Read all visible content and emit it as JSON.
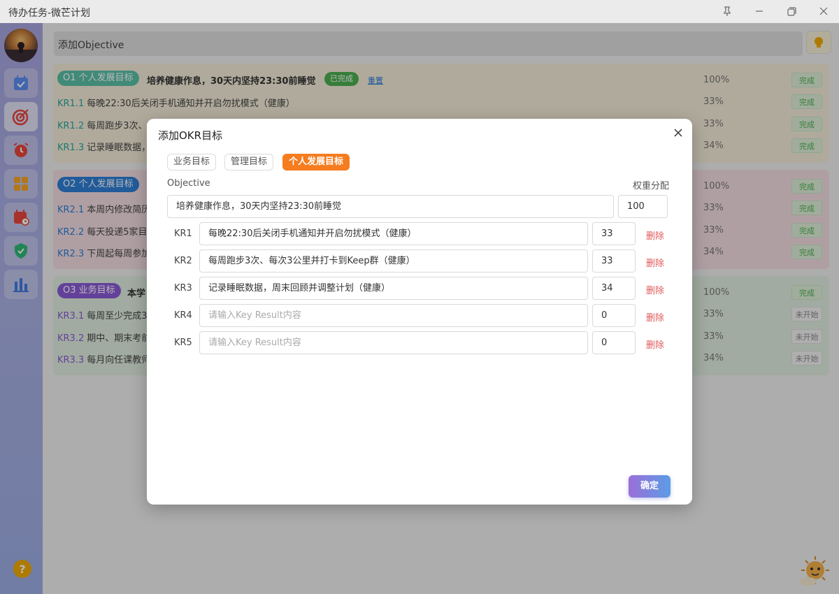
{
  "window": {
    "title": "待办任务-微芒计划",
    "buttons": [
      "pin",
      "minimize",
      "maximize",
      "close"
    ]
  },
  "main": {
    "add_objective_placeholder": "添加Objective",
    "groups": [
      {
        "tag": "O1 个人发展目标",
        "tag_color": "#5bbfa7",
        "title": "培养健康作息，30天内坚持23:30前睡觉",
        "done_badge": "已完成",
        "reset_label": "重置",
        "percent": "100%",
        "status": "完成",
        "krs": [
          {
            "code": "KR1.1",
            "text": "每晚22:30后关闭手机通知并开启勿扰模式（健康）",
            "percent": "33%",
            "status": "完成"
          },
          {
            "code": "KR1.2",
            "text": "每周跑步3次、",
            "percent": "33%",
            "status": "完成"
          },
          {
            "code": "KR1.3",
            "text": "记录睡眠数据，",
            "percent": "34%",
            "status": "完成"
          }
        ]
      },
      {
        "tag": "O2 个人发展目标",
        "tag_color": "#2f7fd6",
        "title": "",
        "percent": "100%",
        "status": "完成",
        "krs": [
          {
            "code": "KR2.1",
            "text": "本周内修改简历",
            "percent": "33%",
            "status": "完成"
          },
          {
            "code": "KR2.2",
            "text": "每天投递5家目",
            "percent": "33%",
            "status": "完成"
          },
          {
            "code": "KR2.3",
            "text": "下周起每周参加",
            "percent": "34%",
            "status": "完成"
          }
        ]
      },
      {
        "tag": "O3 业务目标",
        "tag_color": "#8a5bd6",
        "title": "本学",
        "percent": "100%",
        "status": "完成",
        "krs": [
          {
            "code": "KR3.1",
            "text": "每周至少完成3",
            "percent": "33%",
            "status": "未开始"
          },
          {
            "code": "KR3.2",
            "text": "期中、期末考前",
            "percent": "33%",
            "status": "未开始"
          },
          {
            "code": "KR3.3",
            "text": "每月向任课教师",
            "percent": "34%",
            "status": "未开始"
          }
        ]
      }
    ]
  },
  "modal": {
    "title": "添加OKR目标",
    "tabs": [
      "业务目标",
      "管理目标",
      "个人发展目标"
    ],
    "active_tab": "个人发展目标",
    "objective_label": "Objective",
    "weight_label": "权重分配",
    "objective_value": "培养健康作息，30天内坚持23:30前睡觉",
    "objective_weight": "100",
    "delete_label": "删除",
    "kr_placeholder": "请输入Key Result内容",
    "key_results": [
      {
        "label": "KR1",
        "value": "每晚22:30后关闭手机通知并开启勿扰模式（健康）",
        "weight": "33"
      },
      {
        "label": "KR2",
        "value": "每周跑步3次、每次3公里并打卡到Keep群（健康）",
        "weight": "33"
      },
      {
        "label": "KR3",
        "value": "记录睡眠数据，周末回顾并调整计划（健康）",
        "weight": "34"
      },
      {
        "label": "KR4",
        "value": "",
        "weight": "0"
      },
      {
        "label": "KR5",
        "value": "",
        "weight": "0"
      }
    ],
    "confirm_label": "确定"
  },
  "sidebar": {
    "help_label": "?"
  },
  "colors": {
    "accent_orange": "#f57c1f",
    "delete_red": "#e05a5a",
    "done_green": "#4caf50"
  }
}
